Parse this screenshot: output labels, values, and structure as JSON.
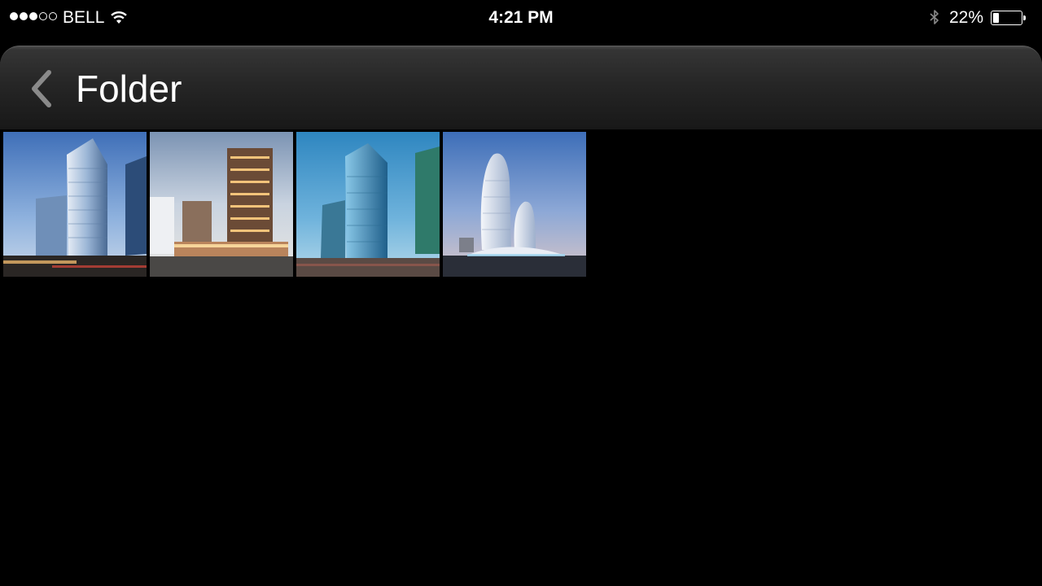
{
  "status_bar": {
    "carrier": "BELL",
    "signal_bars_filled": 3,
    "signal_bars_total": 5,
    "time": "4:21 PM",
    "battery_percent_label": "22%",
    "battery_level": 0.22
  },
  "nav": {
    "title": "Folder",
    "back_icon": "chevron-left-icon"
  },
  "thumbnails": [
    {
      "subject": "building-render-1"
    },
    {
      "subject": "building-render-2"
    },
    {
      "subject": "building-render-3"
    },
    {
      "subject": "building-render-4"
    }
  ],
  "colors": {
    "background": "#000000",
    "nav_bar_top": "#4a4a4a",
    "nav_bar_bottom": "#181818",
    "back_chevron": "#8a8a8a"
  }
}
